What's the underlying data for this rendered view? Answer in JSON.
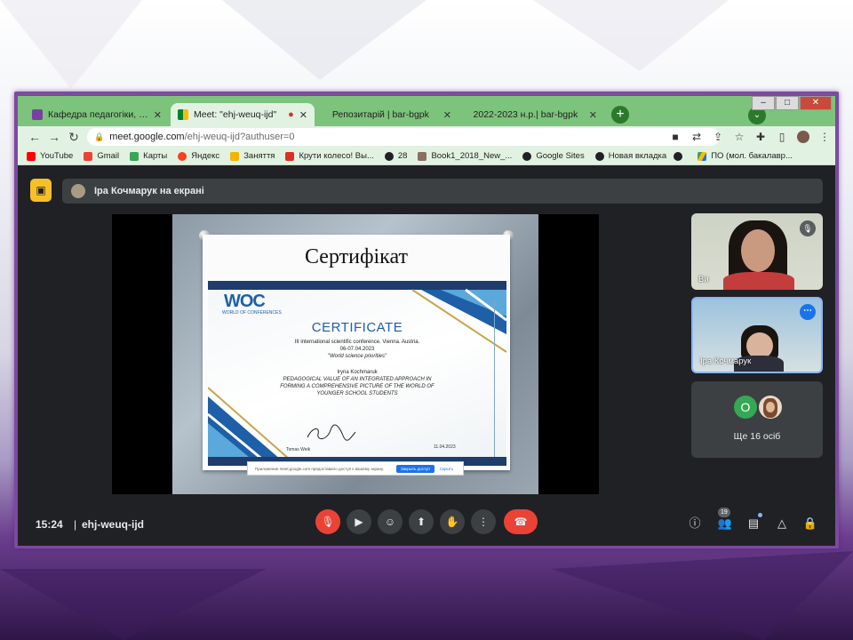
{
  "tabs": [
    {
      "label": "Кафедра педагогіки, психології",
      "active": false,
      "icon": "classroom-icon",
      "color": "#7b3fa1"
    },
    {
      "label": "Meet: \"ehj-weuq-ijd\"",
      "active": true,
      "icon": "meet-icon",
      "color": "#00832d"
    },
    {
      "label": "Репозитарій | bar-bgpk",
      "active": false
    },
    {
      "label": "2022-2023 н.р.| bar-bgpk",
      "active": false
    }
  ],
  "address": {
    "host": "meet.google.com",
    "path": "/ehj-weuq-ijd?authuser=0"
  },
  "bookmarks": [
    {
      "label": "YouTube",
      "color": "#ff0000"
    },
    {
      "label": "Gmail",
      "color": "#ea4335"
    },
    {
      "label": "Карты",
      "color": "#34a853"
    },
    {
      "label": "Яндекс",
      "color": "#fc3f1d"
    },
    {
      "label": "Заняття",
      "color": "#f4b400"
    },
    {
      "label": "Крути колесо! Вы...",
      "color": "#d93025"
    },
    {
      "label": "28",
      "color": "#202124"
    },
    {
      "label": "Book1_2018_New_...",
      "color": "#8d6e63"
    },
    {
      "label": "Google Sites",
      "color": "#202124"
    },
    {
      "label": "Новая вкладка",
      "color": "#202124"
    },
    {
      "label": "ПО (мол. бакалавр...",
      "color": "#1a73e8"
    }
  ],
  "presentation": {
    "presenter_text": "Іра Кочмарук на екрані"
  },
  "slide": {
    "title": "Сертифікат",
    "logo": "WOC",
    "logo_sub": "WORLD OF CONFERENCES",
    "heading": "CERTIFICATE",
    "line1": "III international scientific conference. Vienna. Austria.",
    "line2": "06-07.04.2023",
    "line3": "\"World science priorities\"",
    "name": "Iryna Kochmaruk",
    "topic1": "PEDAGOGICAL VALUE OF AN INTEGRATED APPROACH IN",
    "topic2": "FORMING A COMPREHENSIVE PICTURE OF THE WORLD OF",
    "topic3": "YOUNGER SCHOOL STUDENTS",
    "signer": "Tomas Weik",
    "date": "11.04.2023",
    "notice_text": "Приложение meet.google.com предоставило доступ к вашему экрану.",
    "notice_btn": "Закрыть доступ",
    "notice_close": "Скрыть"
  },
  "participants": [
    {
      "name": "Ви"
    },
    {
      "name": "Іра Кочмарук"
    }
  ],
  "more": {
    "avatar_letter": "O",
    "label": "Ще 16 осіб"
  },
  "controls": {
    "time": "15:24",
    "separator": "|",
    "meeting_code": "ehj-weuq-ijd",
    "people_count": "19"
  },
  "colors": {
    "tab_strip": "#7cc37c",
    "toolbar": "#e2f2e2",
    "meet_bg": "#202124",
    "danger": "#ea4335",
    "accent": "#8ab4f8"
  }
}
